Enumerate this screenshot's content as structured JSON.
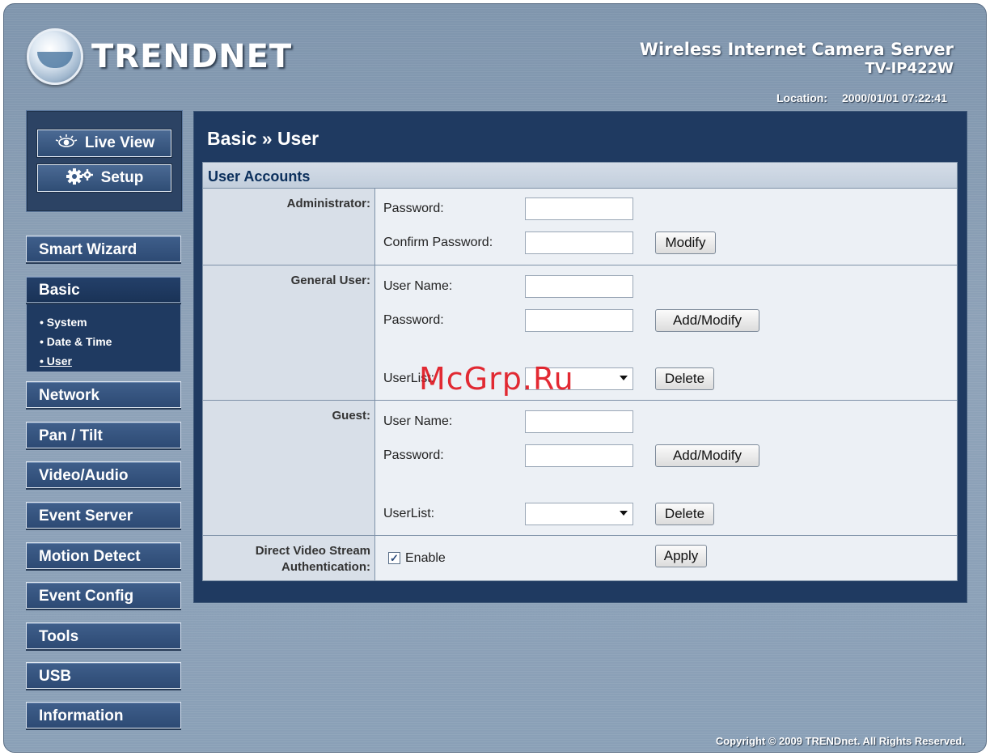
{
  "header": {
    "brand": "TRENDNET",
    "product_line1": "Wireless Internet Camera Server",
    "product_line2": "TV-IP422W",
    "location_label": "Location:",
    "datetime": "2000/01/01 07:22:41"
  },
  "topnav": {
    "live_view": "Live View",
    "setup": "Setup"
  },
  "nav": {
    "smart_wizard": "Smart Wizard",
    "basic": "Basic",
    "basic_sub": [
      "• System",
      "• Date & Time",
      "• User"
    ],
    "network": "Network",
    "pan_tilt": "Pan / Tilt",
    "video_audio": "Video/Audio",
    "event_server": "Event Server",
    "motion_detect": "Motion Detect",
    "event_config": "Event Config",
    "tools": "Tools",
    "usb": "USB",
    "information": "Information"
  },
  "page": {
    "title": "Basic » User",
    "section_title": "User Accounts"
  },
  "admin": {
    "label": "Administrator:",
    "password_label": "Password:",
    "password_value": "",
    "confirm_label": "Confirm Password:",
    "confirm_value": "",
    "modify_button": "Modify"
  },
  "general_user": {
    "label": "General User:",
    "username_label": "User Name:",
    "username_value": "",
    "password_label": "Password:",
    "password_value": "",
    "add_modify_button": "Add/Modify",
    "userlist_label": "UserList:",
    "userlist_selected": "",
    "delete_button": "Delete"
  },
  "guest": {
    "label": "Guest:",
    "username_label": "User Name:",
    "username_value": "",
    "password_label": "Password:",
    "password_value": "",
    "add_modify_button": "Add/Modify",
    "userlist_label": "UserList:",
    "userlist_selected": "",
    "delete_button": "Delete"
  },
  "stream_auth": {
    "label_line1": "Direct Video Stream",
    "label_line2": "Authentication:",
    "checkbox_mark": "✓",
    "enable_label": "Enable",
    "apply_button": "Apply"
  },
  "footer": {
    "copyright": "Copyright © 2009 TRENDnet. All Rights Reserved."
  },
  "watermark": "McGrp.Ru",
  "colors": {
    "background": "#8ea2b8",
    "nav_button": "#2d4a74",
    "panel": "#1f3a61",
    "section_header": "#c2cedc",
    "section_label_bg": "#d8dfe8",
    "section_title_text": "#0b2f5c",
    "watermark": "#e0141e"
  },
  "icons": {
    "live_view": "eye-icon",
    "setup": "gears-icon",
    "dropdown": "chevron-down-icon",
    "checkbox": "checkmark-icon"
  }
}
